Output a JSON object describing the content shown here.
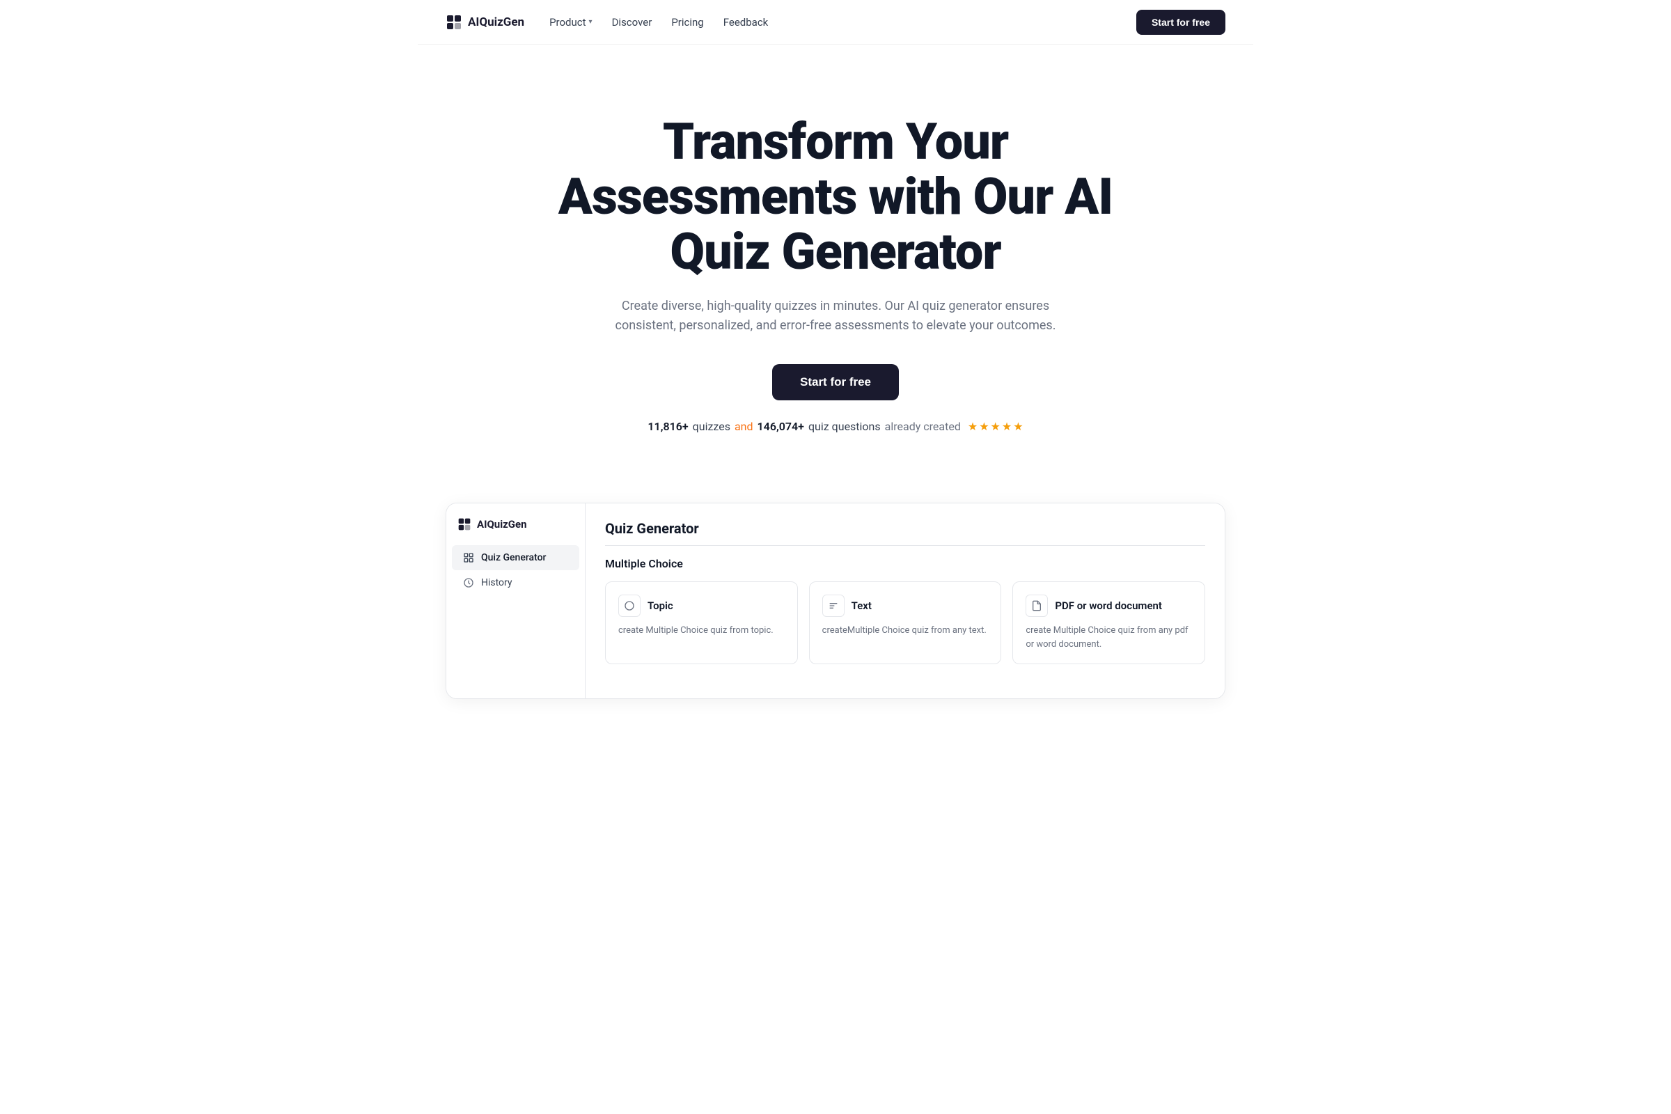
{
  "navbar": {
    "logo_text": "AIQuizGen",
    "nav_items": [
      {
        "label": "Product",
        "has_dropdown": true
      },
      {
        "label": "Discover",
        "has_dropdown": false
      },
      {
        "label": "Pricing",
        "has_dropdown": false
      },
      {
        "label": "Feedback",
        "has_dropdown": false
      }
    ],
    "cta_label": "Start for free"
  },
  "hero": {
    "title": "Transform Your Assessments with Our AI Quiz Generator",
    "subtitle": "Create diverse, high-quality quizzes in minutes. Our AI quiz generator ensures consistent, personalized, and error-free assessments to elevate your outcomes.",
    "cta_label": "Start for free",
    "stats": {
      "quizzes_count": "11,816+",
      "quizzes_label": "quizzes",
      "and_text": "and",
      "questions_count": "146,074+",
      "questions_label": "quiz questions",
      "already_created": "already created"
    },
    "stars_count": 5
  },
  "app_preview": {
    "sidebar": {
      "logo_text": "AIQuizGen",
      "nav_items": [
        {
          "label": "Quiz Generator",
          "icon": "grid-icon",
          "active": true
        },
        {
          "label": "History",
          "icon": "clock-icon",
          "active": false
        }
      ]
    },
    "main": {
      "section_title": "Quiz Generator",
      "subsection_title": "Multiple Choice",
      "quiz_types": [
        {
          "icon": "circle-icon",
          "title": "Topic",
          "description": "create Multiple Choice quiz from topic."
        },
        {
          "icon": "text-icon",
          "title": "Text",
          "description": "createMultiple Choice quiz from any text."
        },
        {
          "icon": "file-icon",
          "title": "PDF or word document",
          "description": "create Multiple Choice quiz from any pdf or word document."
        }
      ]
    }
  }
}
